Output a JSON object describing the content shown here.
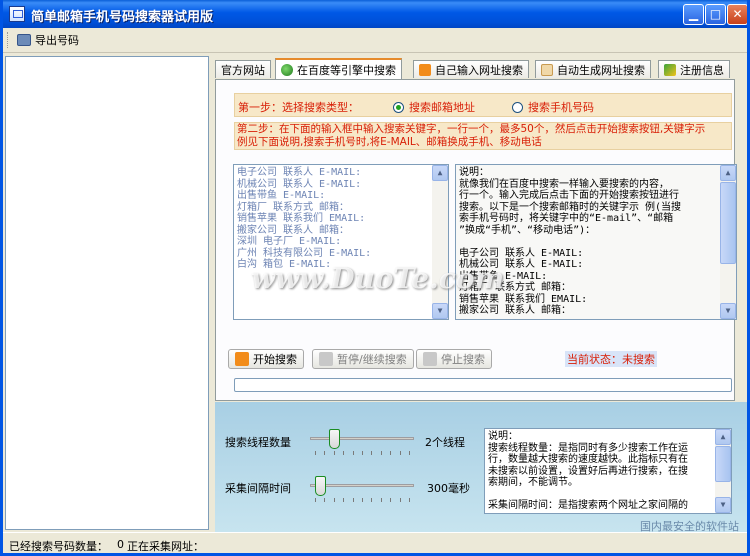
{
  "window": {
    "title": "简单邮箱手机号码搜索器试用版"
  },
  "toolbar": {
    "export_label": "导出号码"
  },
  "tabs": [
    {
      "label": "官方网站"
    },
    {
      "label": "在百度等引擎中搜索"
    },
    {
      "label": "自己输入网址搜索"
    },
    {
      "label": "自动生成网址搜索"
    },
    {
      "label": "注册信息"
    }
  ],
  "step1": {
    "label": "第一步：选择搜索类型：",
    "options": [
      {
        "label": "搜索邮箱地址",
        "selected": true
      },
      {
        "label": "搜索手机号码",
        "selected": false
      }
    ]
  },
  "step2": {
    "text_line1": "第二步：在下面的输入框中输入搜索关键字，一行一个，最多50个，然后点击开始搜索按钮,关键字示",
    "text_line2": "例见下面说明,搜索手机号时,将E-MAIL、邮箱换成手机、移动电话"
  },
  "keywords": [
    "电子公司 联系人 E-MAIL:",
    "机械公司 联系人 E-MAIL:",
    "出售带鱼 E-MAIL:",
    "灯箱厂 联系方式 邮箱：",
    "销售苹果 联系我们 EMAIL:",
    "搬家公司 联系人 邮箱：",
    "深圳 电子厂 E-MAIL:",
    "广州 科技有限公司 E-MAIL:",
    "白沟 箱包 E-MAIL:"
  ],
  "description": {
    "lines": [
      "    说明：",
      "就像我们在百度中搜索一样输入要搜索的内容，",
      "行一个。输入完成后点击下面的开始搜索按钮进行",
      "搜索。以下是一个搜索邮箱时的关键字示 例(当搜",
      "索手机号码时，将关键字中的“E-mail”、“邮箱",
      "”换成“手机”、“移动电话”)：",
      "",
      "电子公司 联系人 E-MAIL:",
      "机械公司 联系人 E-MAIL:",
      "出售带鱼 E-MAIL:",
      "灯箱厂 联系方式 邮箱：",
      "销售苹果 联系我们 EMAIL:",
      "搬家公司 联系人 邮箱："
    ]
  },
  "actions": {
    "start": "开始搜索",
    "pause": "暂停/继续搜索",
    "stop": "停止搜索"
  },
  "status": {
    "text": "当前状态：未搜索"
  },
  "progress": {
    "value": 0
  },
  "settings": {
    "threads": {
      "label": "搜索线程数量",
      "value_label": "2个线程",
      "level": 0.2
    },
    "interval": {
      "label": "采集间隔时间",
      "value_label": "300毫秒",
      "level": 0.05
    }
  },
  "settings_help": {
    "lines": [
      "    说明：",
      "搜索线程数量：是指同时有多少搜索工作在运",
      "行，数量越大搜索的速度越快。此指标只有在",
      "未搜索以前设置，设置好后再进行搜索，在搜",
      "索期间，不能调节。",
      "",
      "采集间隔时间：是指搜索两个网址之家间隔的"
    ]
  },
  "statusbar": {
    "count_label": "已经搜索号码数量：",
    "count_value": "0",
    "url_label": "正在采集网址："
  },
  "watermarks": {
    "center": "www.DuoTe.com",
    "corner": "国内最安全的软件站"
  }
}
